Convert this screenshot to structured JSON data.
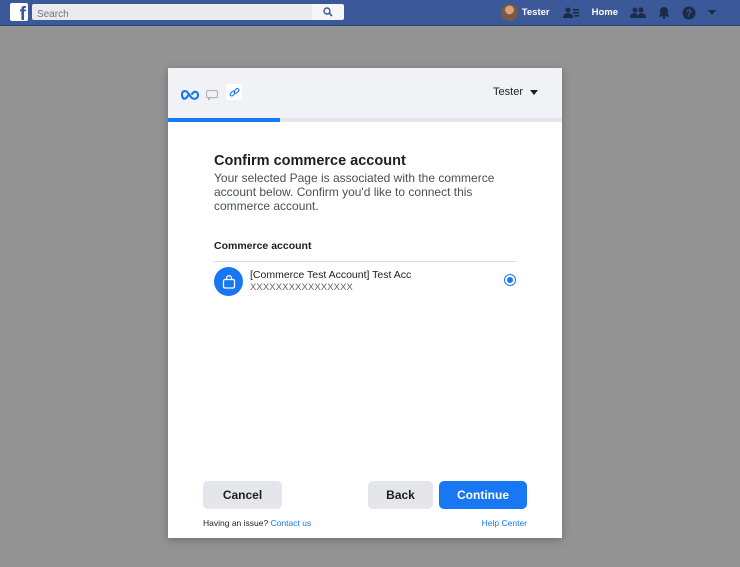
{
  "topbar": {
    "logo_letter": "f",
    "search_placeholder": "Search",
    "user_name": "Tester",
    "home_label": "Home"
  },
  "dialog": {
    "account_switcher_label": "Tester",
    "progress_fraction": 0.285,
    "title": "Confirm commerce account",
    "description": "Your selected Page is associated with the commerce account below. Confirm you'd like to connect this commerce account.",
    "section_label": "Commerce account",
    "account": {
      "name": "[Commerce Test Account] Test Acc",
      "id": "XXXXXXXXXXXXXXXX",
      "selected": true
    },
    "buttons": {
      "cancel": "Cancel",
      "back": "Back",
      "continue": "Continue"
    },
    "footer": {
      "issue_text": "Having an issue?",
      "contact_link": "Contact us",
      "help_link": "Help Center"
    }
  },
  "colors": {
    "topbar": "#3b5998",
    "accent": "#1877f2",
    "overlay": "#939393"
  },
  "icons": [
    "search-icon",
    "friends-icon",
    "people-icon",
    "bell-icon",
    "help-icon",
    "chevron-down-icon",
    "meta-logo-icon",
    "messenger-icon",
    "link-icon",
    "shopping-bag-icon"
  ]
}
